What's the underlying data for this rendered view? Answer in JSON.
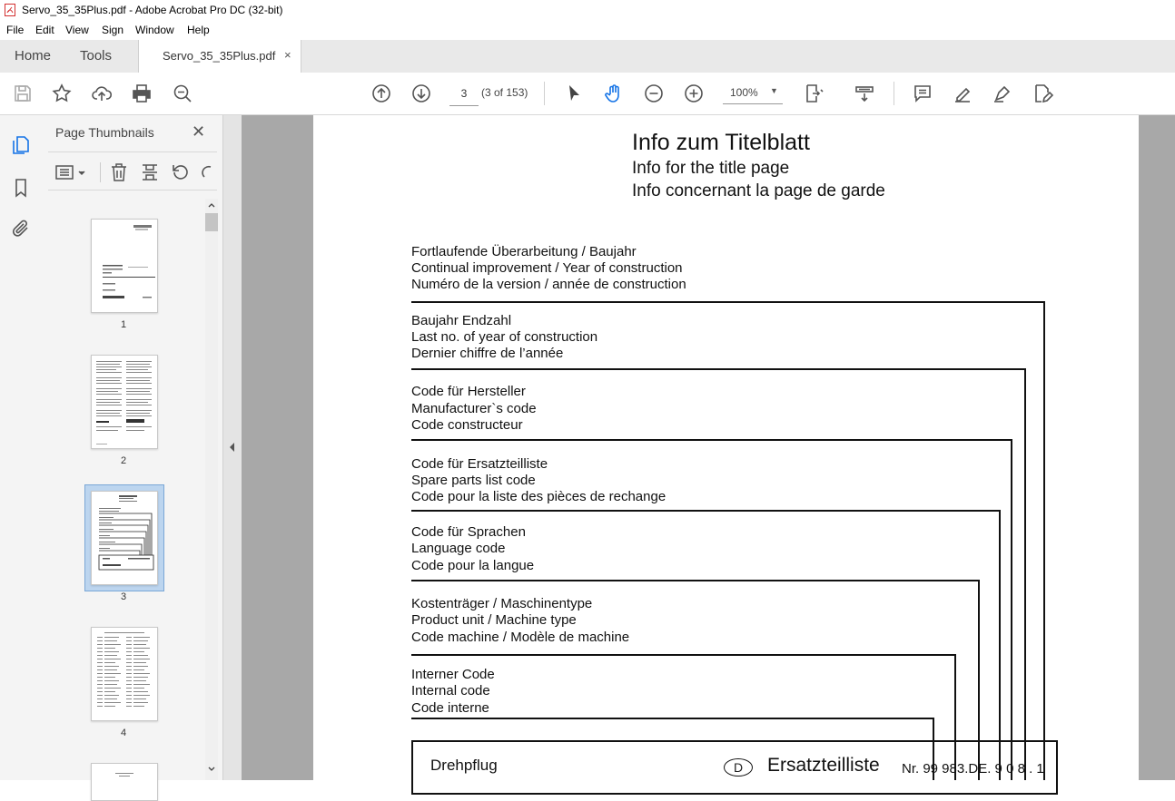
{
  "window": {
    "title": "Servo_35_35Plus.pdf - Adobe Acrobat Pro DC (32-bit)"
  },
  "menu": [
    "File",
    "Edit",
    "View",
    "Sign",
    "Window",
    "Help"
  ],
  "tabs": {
    "home": "Home",
    "tools": "Tools",
    "document": "Servo_35_35Plus.pdf",
    "close": "×"
  },
  "toolbar": {
    "page_value": "3",
    "page_count": "(3 of 153)",
    "zoom": "100%"
  },
  "panel": {
    "title": "Page Thumbnails",
    "close": "✕",
    "thumbnails": [
      "1",
      "2",
      "3",
      "4"
    ],
    "selected": "3"
  },
  "page": {
    "title_de": "Info  zum  Titelblatt",
    "title_en": "Info for the title page",
    "title_fr": "Info concernant la page de garde",
    "sections": [
      [
        "Fortlaufende Überarbeitung / Baujahr",
        "Continual improvement / Year of construction",
        "Numéro de la version / année de construction"
      ],
      [
        "Baujahr Endzahl",
        "Last no. of year of construction",
        "Dernier chiffre de l’année"
      ],
      [
        "Code für Hersteller",
        "Manufacturer`s  code",
        "Code constructeur"
      ],
      [
        "Code für Ersatzteilliste",
        "Spare parts list code",
        "Code pour la liste des pièces de rechange"
      ],
      [
        "Code für Sprachen",
        "Language code",
        "Code pour la langue"
      ],
      [
        "Kostenträger / Maschinentype",
        "Product unit / Machine type",
        "Code machine / Modèle de machine"
      ],
      [
        "Interner Code",
        "Internal code",
        "Code interne"
      ]
    ],
    "box": {
      "left_text": "Drehpflug",
      "lang_badge": "D",
      "doc_type": "Ersatzteilliste",
      "number": "Nr. 99 983.DE. 9 0 8 . 1"
    }
  }
}
